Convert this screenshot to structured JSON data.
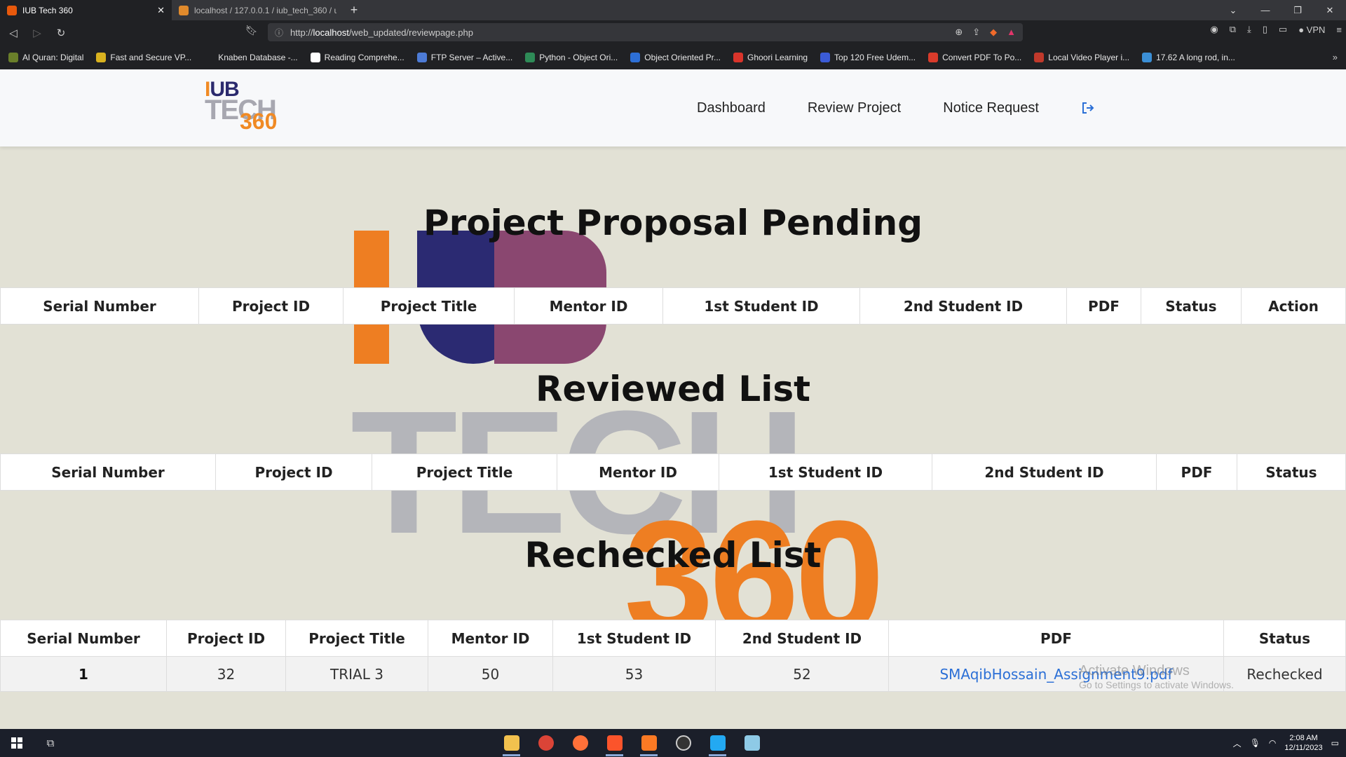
{
  "browser": {
    "tabs": [
      {
        "title": "IUB Tech 360",
        "active": true
      },
      {
        "title": "localhost / 127.0.0.1 / iub_tech_360 / u",
        "active": false
      }
    ],
    "url_prefix": "http://",
    "url_host": "localhost",
    "url_path": "/web_updated/reviewpage.php",
    "vpn_label": "VPN",
    "bookmarks": [
      {
        "label": "Al Quran: Digital",
        "color": "#6a7f2a"
      },
      {
        "label": "Fast and Secure VP...",
        "color": "#d9b21f"
      },
      {
        "label": "Knaben Database -...",
        "color": "#202124"
      },
      {
        "label": "Reading Comprehe...",
        "color": "#ffffff"
      },
      {
        "label": "FTP Server – Active...",
        "color": "#4d7bd6"
      },
      {
        "label": "Python - Object Ori...",
        "color": "#2e8b57"
      },
      {
        "label": "Object Oriented Pr...",
        "color": "#2d6fd6"
      },
      {
        "label": "Ghoori Learning",
        "color": "#d9342b"
      },
      {
        "label": "Top 120 Free Udem...",
        "color": "#3b5bd6"
      },
      {
        "label": "Convert PDF To Po...",
        "color": "#d93b2b"
      },
      {
        "label": "Local Video Player i...",
        "color": "#c0392b"
      },
      {
        "label": "17.62 A long rod, in...",
        "color": "#3b8fd6"
      }
    ]
  },
  "site": {
    "logo": {
      "line1a": "I",
      "line1b": "UB",
      "line2": "TECH",
      "line3": "360"
    },
    "nav": [
      "Dashboard",
      "Review Project",
      "Notice Request"
    ],
    "logout_icon": "logout-icon"
  },
  "sections": {
    "pending": {
      "title": "Project Proposal Pending",
      "headers": [
        "Serial Number",
        "Project ID",
        "Project Title",
        "Mentor ID",
        "1st Student ID",
        "2nd Student ID",
        "PDF",
        "Status",
        "Action"
      ],
      "rows": []
    },
    "reviewed": {
      "title": "Reviewed List",
      "headers": [
        "Serial Number",
        "Project ID",
        "Project Title",
        "Mentor ID",
        "1st Student ID",
        "2nd Student ID",
        "PDF",
        "Status"
      ],
      "rows": []
    },
    "rechecked": {
      "title": "Rechecked List",
      "headers": [
        "Serial Number",
        "Project ID",
        "Project Title",
        "Mentor ID",
        "1st Student ID",
        "2nd Student ID",
        "PDF",
        "Status"
      ],
      "rows": [
        {
          "serial": "1",
          "project_id": "32",
          "title": "TRIAL 3",
          "mentor_id": "50",
          "student1": "53",
          "student2": "52",
          "pdf": "SMAqibHossain_Assignment9.pdf",
          "status": "Rechecked"
        }
      ]
    }
  },
  "watermark": {
    "line1": "IUB",
    "line2": "TECH",
    "line3": "360"
  },
  "os": {
    "activate_title": "Activate Windows",
    "activate_sub": "Go to Settings to activate Windows.",
    "time": "2:08 AM",
    "date": "12/11/2023"
  }
}
